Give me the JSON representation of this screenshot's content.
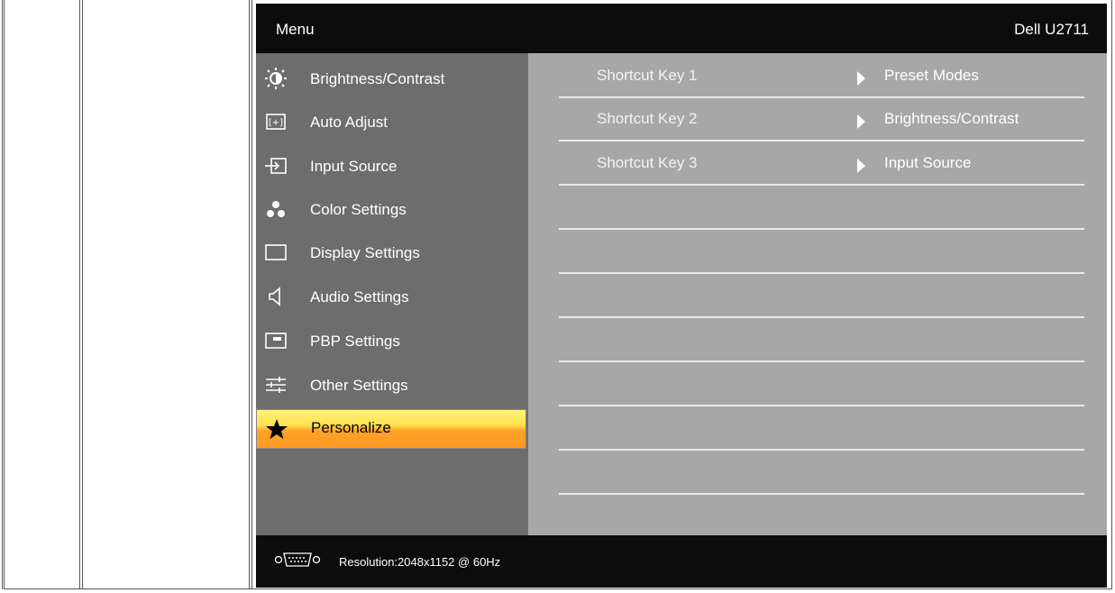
{
  "header": {
    "menu_label": "Menu",
    "model": "Dell U2711"
  },
  "menu_items": [
    {
      "label": "Brightness/Contrast",
      "icon": "brightness-icon"
    },
    {
      "label": "Auto Adjust",
      "icon": "auto-adjust-icon"
    },
    {
      "label": "Input Source",
      "icon": "input-source-icon"
    },
    {
      "label": "Color Settings",
      "icon": "color-settings-icon"
    },
    {
      "label": "Display Settings",
      "icon": "display-settings-icon"
    },
    {
      "label": "Audio Settings",
      "icon": "speaker-icon"
    },
    {
      "label": "PBP Settings",
      "icon": "pbp-icon"
    },
    {
      "label": "Other Settings",
      "icon": "sliders-icon"
    },
    {
      "label": "Personalize",
      "icon": "star-icon",
      "selected": true
    }
  ],
  "shortcuts": [
    {
      "key": "Shortcut Key 1",
      "value": "Preset Modes"
    },
    {
      "key": "Shortcut Key 2",
      "value": "Brightness/Contrast"
    },
    {
      "key": "Shortcut Key 3",
      "value": "Input Source"
    }
  ],
  "footer": {
    "resolution": "Resolution:2048x1152 @ 60Hz",
    "connector_icon": "vga-connector-icon"
  },
  "colors": {
    "selected_top": "#ffe14d",
    "selected_bottom": "#ff9a22",
    "bar": "#0c0c0c",
    "panel_left": "#6d6d6d",
    "panel_right": "#a7a7a7"
  }
}
